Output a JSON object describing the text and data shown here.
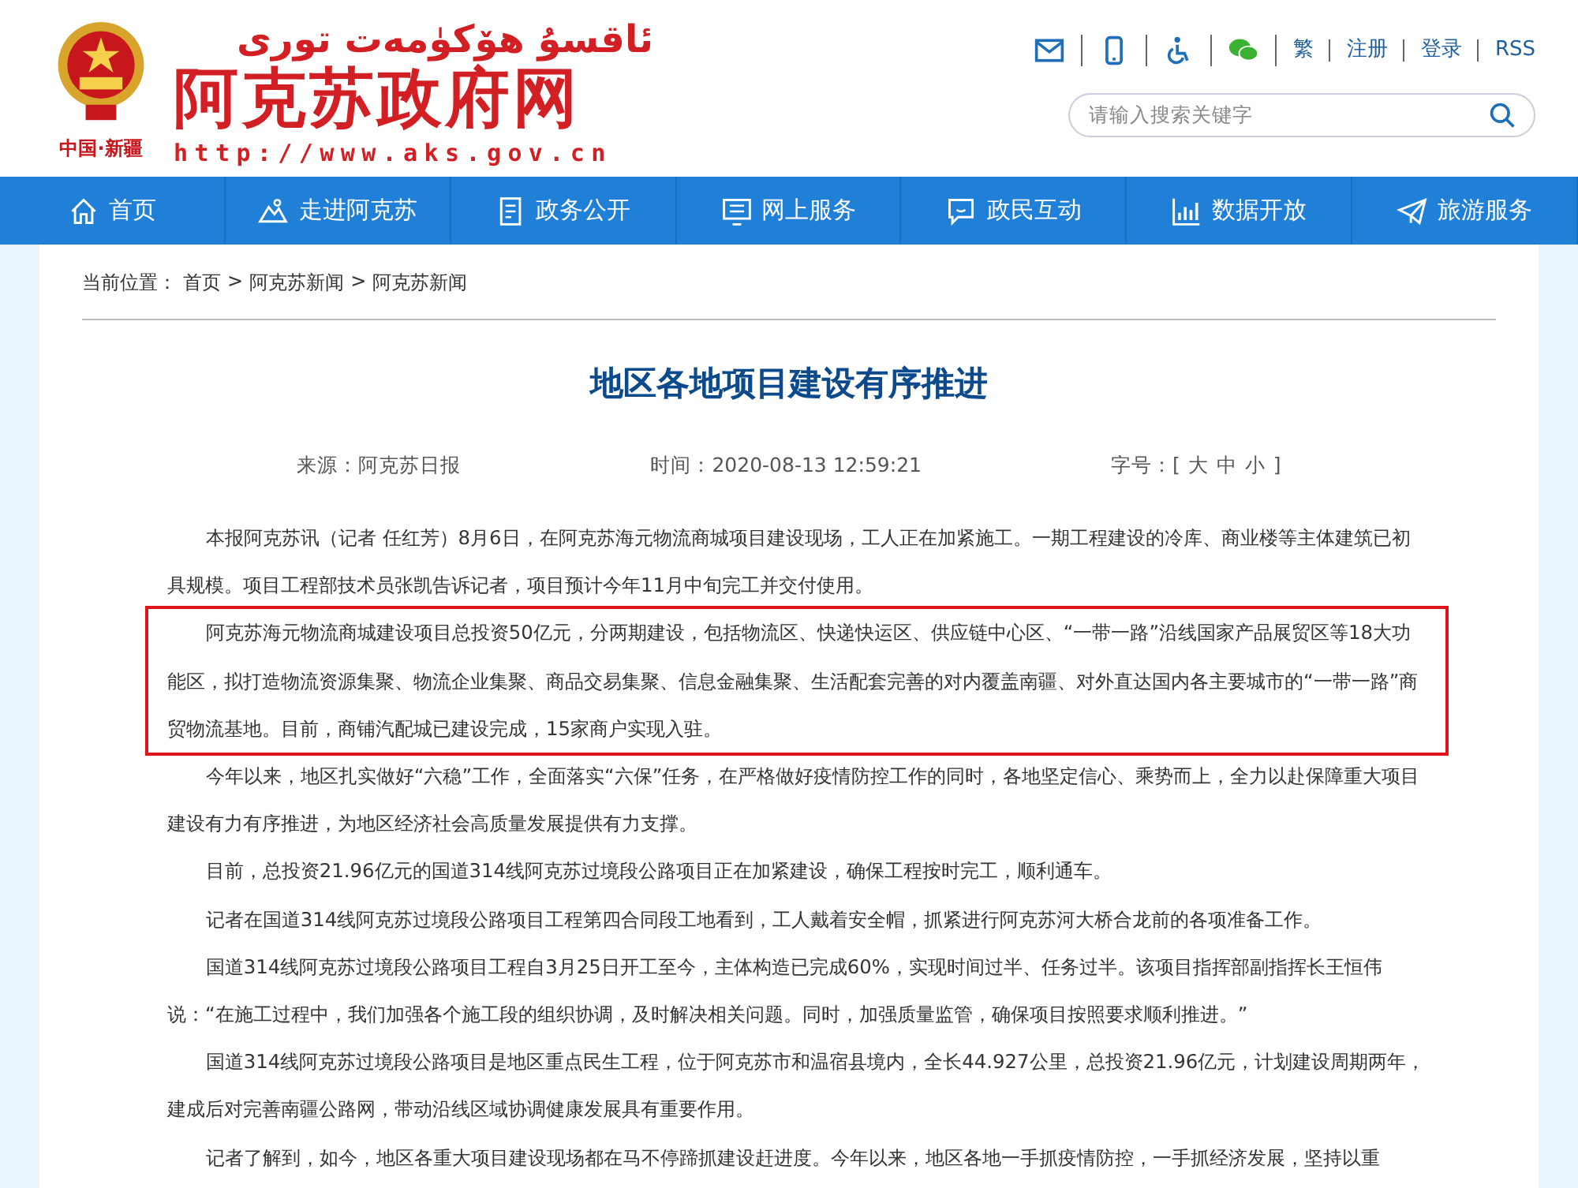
{
  "header": {
    "emblem_caption": "中国·新疆",
    "uyghur_title": "ئاقسۇ ھۆكۈمەت تورى",
    "site_name": "阿克苏政府网",
    "url": "http://www.aks.gov.cn",
    "quick_icons": [
      {
        "kind": "mail"
      },
      {
        "kind": "mobile"
      },
      {
        "kind": "accessibility"
      },
      {
        "kind": "wechat"
      }
    ],
    "links": [
      "繁",
      "注册",
      "登录",
      "RSS"
    ],
    "search": {
      "placeholder": "请输入搜索关键字"
    }
  },
  "nav": [
    {
      "kind": "home",
      "label": "首页"
    },
    {
      "kind": "scenery",
      "label": "走进阿克苏"
    },
    {
      "kind": "document",
      "label": "政务公开"
    },
    {
      "kind": "monitor",
      "label": "网上服务"
    },
    {
      "kind": "chat",
      "label": "政民互动"
    },
    {
      "kind": "chart",
      "label": "数据开放"
    },
    {
      "kind": "plane",
      "label": "旅游服务"
    }
  ],
  "breadcrumb": {
    "label": "当前位置：",
    "separator": ">",
    "items": [
      "首页",
      "阿克苏新闻",
      "阿克苏新闻"
    ]
  },
  "article": {
    "title": "地区各地项目建设有序推进",
    "source": "来源：阿克苏日报",
    "time": "时间：2020-08-13 12:59:21",
    "font_size": {
      "label": "字号：[",
      "options": [
        "大",
        "中",
        "小"
      ],
      "close": "]"
    },
    "paragraphs": [
      {
        "text": "本报阿克苏讯（记者 任红芳）8月6日，在阿克苏海元物流商城项目建设现场，工人正在加紧施工。一期工程建设的冷库、商业楼等主体建筑已初具规模。项目工程部技术员张凯告诉记者，项目预计今年11月中旬完工并交付使用。",
        "highlighted": false
      },
      {
        "text": "阿克苏海元物流商城建设项目总投资50亿元，分两期建设，包括物流区、快递快运区、供应链中心区、“一带一路”沿线国家产品展贸区等18大功能区，拟打造物流资源集聚、物流企业集聚、商品交易集聚、信息金融集聚、生活配套完善的对内覆盖南疆、对外直达国内各主要城市的“一带一路”商贸物流基地。目前，商铺汽配城已建设完成，15家商户实现入驻。",
        "highlighted": true
      },
      {
        "text": "今年以来，地区扎实做好“六稳”工作，全面落实“六保”任务，在严格做好疫情防控工作的同时，各地坚定信心、乘势而上，全力以赴保障重大项目建设有力有序推进，为地区经济社会高质量发展提供有力支撑。",
        "highlighted": false
      },
      {
        "text": "目前，总投资21.96亿元的国道314线阿克苏过境段公路项目正在加紧建设，确保工程按时完工，顺利通车。",
        "highlighted": false
      },
      {
        "text": "记者在国道314线阿克苏过境段公路项目工程第四合同段工地看到，工人戴着安全帽，抓紧进行阿克苏河大桥合龙前的各项准备工作。",
        "highlighted": false
      },
      {
        "text": "国道314线阿克苏过境段公路项目工程自3月25日开工至今，主体构造已完成60%，实现时间过半、任务过半。该项目指挥部副指挥长王恒伟说：“在施工过程中，我们加强各个施工段的组织协调，及时解决相关问题。同时，加强质量监管，确保项目按照要求顺利推进。”",
        "highlighted": false
      },
      {
        "text": "国道314线阿克苏过境段公路项目是地区重点民生工程，位于阿克苏市和温宿县境内，全长44.927公里，总投资21.96亿元，计划建设周期两年，建成后对完善南疆公路网，带动沿线区域协调健康发展具有重要作用。",
        "highlighted": false
      },
      {
        "text": "记者了解到，如今，地区各重大项目建设现场都在马不停蹄抓建设赶进度。今年以来，地区各地一手抓疫情防控，一手抓经济发展，坚持以重",
        "highlighted": false
      }
    ]
  }
}
